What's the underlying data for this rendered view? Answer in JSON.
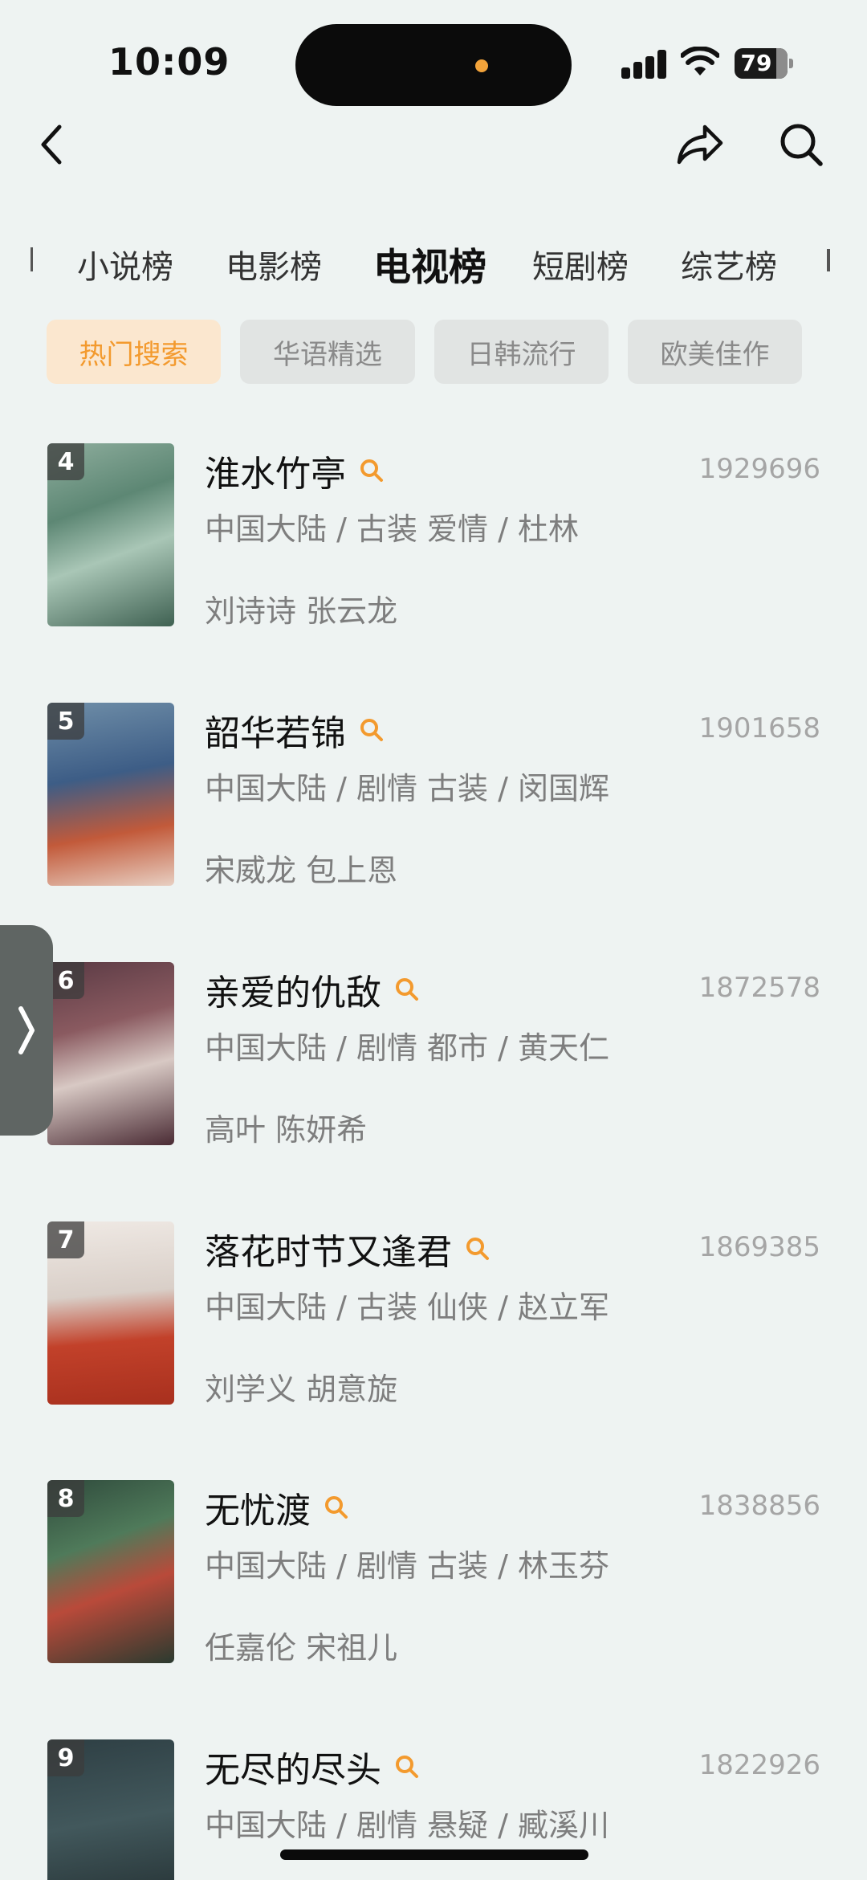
{
  "status_bar": {
    "time": "10:09",
    "battery": "79"
  },
  "category_tabs": [
    {
      "label": "小说榜",
      "active": false
    },
    {
      "label": "电影榜",
      "active": false
    },
    {
      "label": "电视榜",
      "active": true
    },
    {
      "label": "短剧榜",
      "active": false
    },
    {
      "label": "综艺榜",
      "active": false
    }
  ],
  "filter_chips": [
    {
      "label": "热门搜索",
      "active": true
    },
    {
      "label": "华语精选",
      "active": false
    },
    {
      "label": "日韩流行",
      "active": false
    },
    {
      "label": "欧美佳作",
      "active": false
    }
  ],
  "items": [
    {
      "rank": "4",
      "title": "淮水竹亭",
      "heat": "1929696",
      "meta": "中国大陆 / 古装 爱情 / 杜林",
      "cast": "刘诗诗 张云龙"
    },
    {
      "rank": "5",
      "title": "韶华若锦",
      "heat": "1901658",
      "meta": "中国大陆 / 剧情 古装 / 闵国辉",
      "cast": "宋威龙 包上恩"
    },
    {
      "rank": "6",
      "title": "亲爱的仇敌",
      "heat": "1872578",
      "meta": "中国大陆 / 剧情 都市 / 黄天仁",
      "cast": "高叶 陈妍希"
    },
    {
      "rank": "7",
      "title": "落花时节又逢君",
      "heat": "1869385",
      "meta": "中国大陆 / 古装 仙侠 / 赵立军",
      "cast": "刘学义 胡意旋"
    },
    {
      "rank": "8",
      "title": "无忧渡",
      "heat": "1838856",
      "meta": "中国大陆 / 剧情 古装 / 林玉芬",
      "cast": "任嘉伦 宋祖儿"
    },
    {
      "rank": "9",
      "title": "无尽的尽头",
      "heat": "1822926",
      "meta": "中国大陆 / 剧情 悬疑 / 臧溪川",
      "cast": ""
    }
  ],
  "colors": {
    "accent": "#f39a2e",
    "background": "#eef3f2"
  },
  "icons": {
    "back": "chevron-left-icon",
    "share": "share-arrow-icon",
    "search": "search-icon",
    "title_search": "magnifier-icon",
    "handle": "chevron-right-icon"
  }
}
